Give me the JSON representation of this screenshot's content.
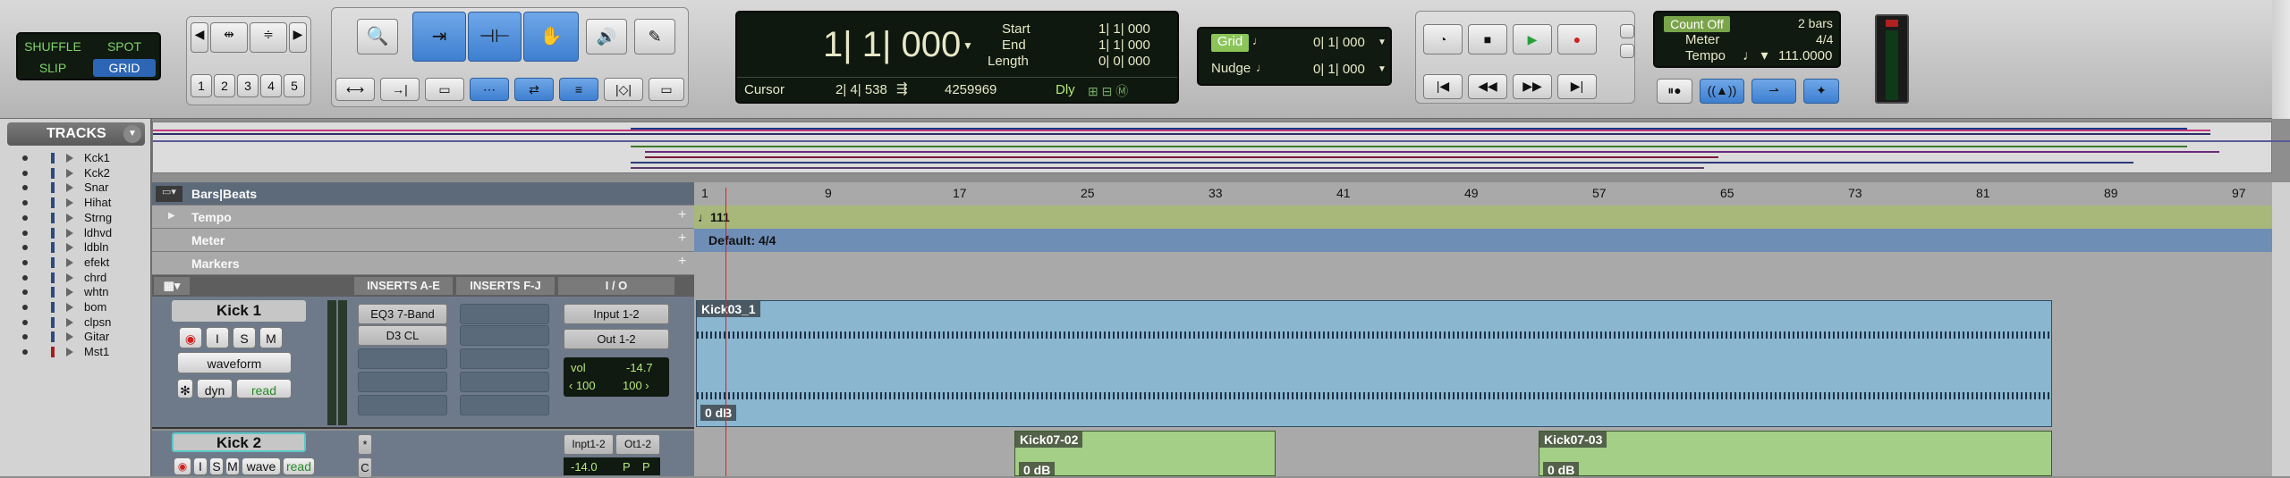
{
  "edit_modes": {
    "shuffle": "SHUFFLE",
    "spot": "SPOT",
    "slip": "SLIP",
    "grid": "GRID"
  },
  "zoom_presets": [
    "1",
    "2",
    "3",
    "4",
    "5"
  ],
  "counter": {
    "main": "1| 1| 000",
    "start_label": "Start",
    "end_label": "End",
    "length_label": "Length",
    "start": "1| 1| 000",
    "end": "1| 1| 000",
    "length": "0| 0| 000",
    "cursor_label": "Cursor",
    "cursor": "2| 4| 538",
    "sample": "4259969",
    "dly": "Dly"
  },
  "grid": {
    "label": "Grid",
    "value": "0| 1| 000",
    "nudge_label": "Nudge",
    "nudge_value": "0| 1| 000"
  },
  "tempo_panel": {
    "count_off": "Count Off",
    "bars": "2 bars",
    "meter_label": "Meter",
    "meter": "4/4",
    "tempo_label": "Tempo",
    "tempo": "111.0000"
  },
  "tracks_header": "TRACKS",
  "tracks": [
    "Kck1",
    "Kck2",
    "Snar",
    "Hihat",
    "Strng",
    "ldhvd",
    "ldbln",
    "efekt",
    "chrd",
    "whtn",
    "bom",
    "clpsn",
    "Gitar",
    "Mst1"
  ],
  "rulers": {
    "bars_beats": "Bars|Beats",
    "tempo": "Tempo",
    "meter": "Meter",
    "markers": "Markers"
  },
  "bar_ticks": [
    "1",
    "9",
    "17",
    "25",
    "33",
    "41",
    "49",
    "57",
    "65",
    "73",
    "81",
    "89",
    "97"
  ],
  "tempo_marker": "111",
  "meter_marker": "Default: 4/4",
  "mix_headers": {
    "a_e": "INSERTS A-E",
    "f_j": "INSERTS F-J",
    "io": "I / O"
  },
  "track1": {
    "name": "Kick 1",
    "rec": "",
    "solo": "S",
    "mute": "M",
    "input_btn": "I",
    "view": "waveform",
    "plugin1": "EQ3 7-Band",
    "plugin2": "D3 CL",
    "input": "Input 1-2",
    "output": "Out 1-2",
    "vol_label": "vol",
    "vol": "-14.7",
    "pan_l": "‹ 100",
    "pan_r": "100 ›",
    "dyn": "dyn",
    "auto": "read",
    "region": "Kick03_1",
    "gain": "0 dB"
  },
  "track2": {
    "name": "Kick 2",
    "solo": "S",
    "mute": "M",
    "input_btn": "I",
    "view": "wave",
    "auto": "read",
    "input": "Inpt1-2",
    "output": "Ot1-2",
    "vol": "-14.0",
    "p1": "P",
    "p2": "P",
    "region1": "Kick07-02",
    "region2": "Kick07-03",
    "gain": "0 dB"
  }
}
